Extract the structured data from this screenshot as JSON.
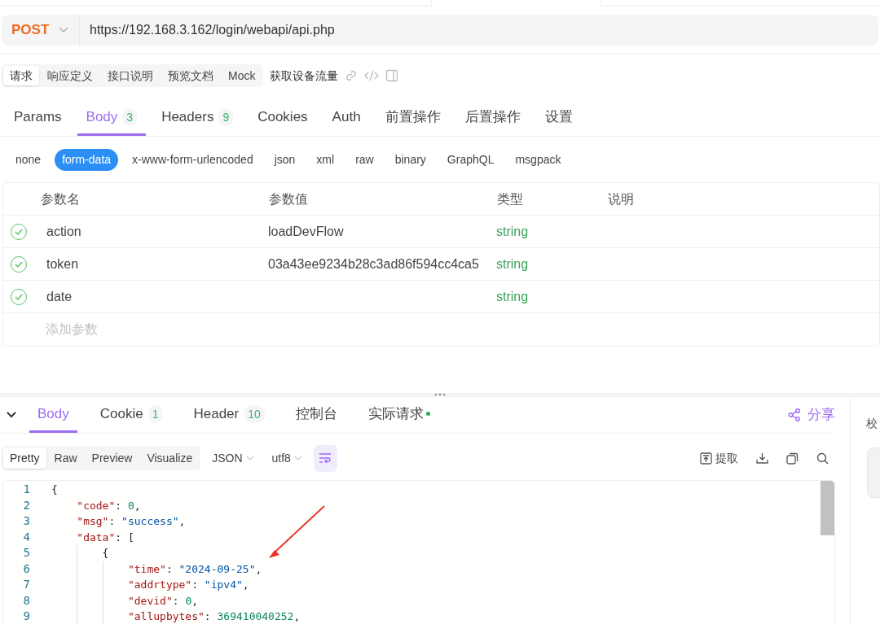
{
  "request": {
    "method": "POST",
    "url": "https://192.168.3.162/login/webapi/api.php"
  },
  "doc_tabs": [
    {
      "label": "请求",
      "selected": true
    },
    {
      "label": "响应定义",
      "selected": false
    },
    {
      "label": "接口说明",
      "selected": false
    },
    {
      "label": "预览文档",
      "selected": false
    },
    {
      "label": "Mock",
      "selected": false
    }
  ],
  "api_name": "获取设备流量",
  "request_tabs": [
    {
      "label": "Params",
      "selected": false
    },
    {
      "label": "Body",
      "count": "3",
      "selected": true
    },
    {
      "label": "Headers",
      "count": "9",
      "selected": false
    },
    {
      "label": "Cookies",
      "selected": false
    },
    {
      "label": "Auth",
      "selected": false
    },
    {
      "label": "前置操作",
      "selected": false
    },
    {
      "label": "后置操作",
      "selected": false
    },
    {
      "label": "设置",
      "selected": false
    }
  ],
  "body_types": [
    {
      "label": "none",
      "selected": false
    },
    {
      "label": "form-data",
      "selected": true
    },
    {
      "label": "x-www-form-urlencoded",
      "selected": false
    },
    {
      "label": "json",
      "selected": false
    },
    {
      "label": "xml",
      "selected": false
    },
    {
      "label": "raw",
      "selected": false
    },
    {
      "label": "binary",
      "selected": false
    },
    {
      "label": "GraphQL",
      "selected": false
    },
    {
      "label": "msgpack",
      "selected": false
    }
  ],
  "params_table": {
    "columns": [
      "参数名",
      "参数值",
      "类型",
      "说明"
    ],
    "rows": [
      {
        "checked": true,
        "name": "action",
        "value": "loadDevFlow",
        "type": "string"
      },
      {
        "checked": true,
        "name": "token",
        "value": "03a43ee9234b28c3ad86f594cc4ca5",
        "type": "string"
      },
      {
        "checked": true,
        "name": "date",
        "type": "string"
      }
    ],
    "add_placeholder": "添加参数"
  },
  "response_tabs": [
    {
      "label": "Body",
      "selected": true
    },
    {
      "label": "Cookie",
      "count": "1",
      "selected": false
    },
    {
      "label": "Header",
      "count": "10",
      "selected": false
    },
    {
      "label": "控制台",
      "selected": false
    },
    {
      "label": "实际请求",
      "dot": true,
      "selected": false
    }
  ],
  "share": "分享",
  "view_modes": [
    {
      "label": "Pretty",
      "selected": true
    },
    {
      "label": "Raw",
      "selected": false
    },
    {
      "label": "Preview",
      "selected": false
    },
    {
      "label": "Visualize",
      "selected": false
    }
  ],
  "format": "JSON",
  "encoding": "utf8",
  "wrap_on": true,
  "extract": "提取",
  "side_panel": {
    "label": "校"
  },
  "code_lines": [
    {
      "number": "1",
      "text": "{"
    },
    {
      "number": "2",
      "text": "    \"code\": 0,"
    },
    {
      "number": "3",
      "text": "    \"msg\": \"success\","
    },
    {
      "number": "4",
      "text": "    \"data\": ["
    },
    {
      "number": "5",
      "text": "        {"
    },
    {
      "number": "6",
      "text": "            \"time\": \"2024-09-25\","
    },
    {
      "number": "7",
      "text": "            \"addrtype\": \"ipv4\","
    },
    {
      "number": "8",
      "text": "            \"devid\": 0,"
    },
    {
      "number": "9",
      "text": "            \"allupbytes\": 369410040252,"
    }
  ]
}
